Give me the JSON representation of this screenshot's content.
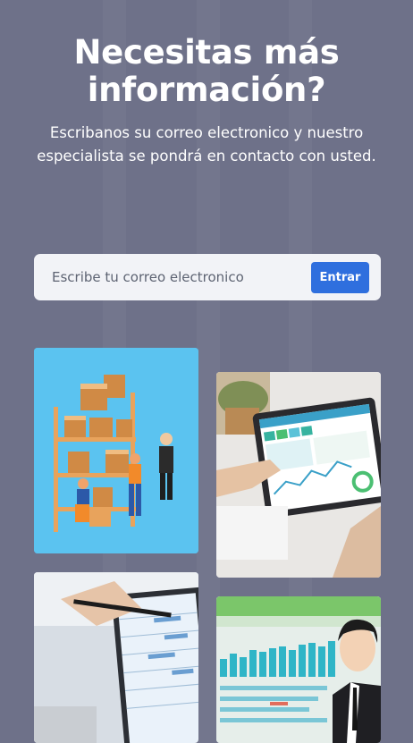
{
  "hero": {
    "title": "Necesitas más\ninformación?",
    "subtitle": "Escribanos su correo electronico y nuestro especialista se pondrá en contacto con usted."
  },
  "form": {
    "email_placeholder": "Escribe tu correo electronico",
    "submit_label": "Entrar"
  },
  "images": [
    {
      "name": "warehouse-illustration"
    },
    {
      "name": "tablet-dashboard-photo"
    },
    {
      "name": "laptop-gantt-photo"
    },
    {
      "name": "businessman-chart-illustration"
    }
  ],
  "colors": {
    "background": "#6e7189",
    "button": "#2f6fde",
    "warehouse_bg": "#5bc3f0"
  }
}
